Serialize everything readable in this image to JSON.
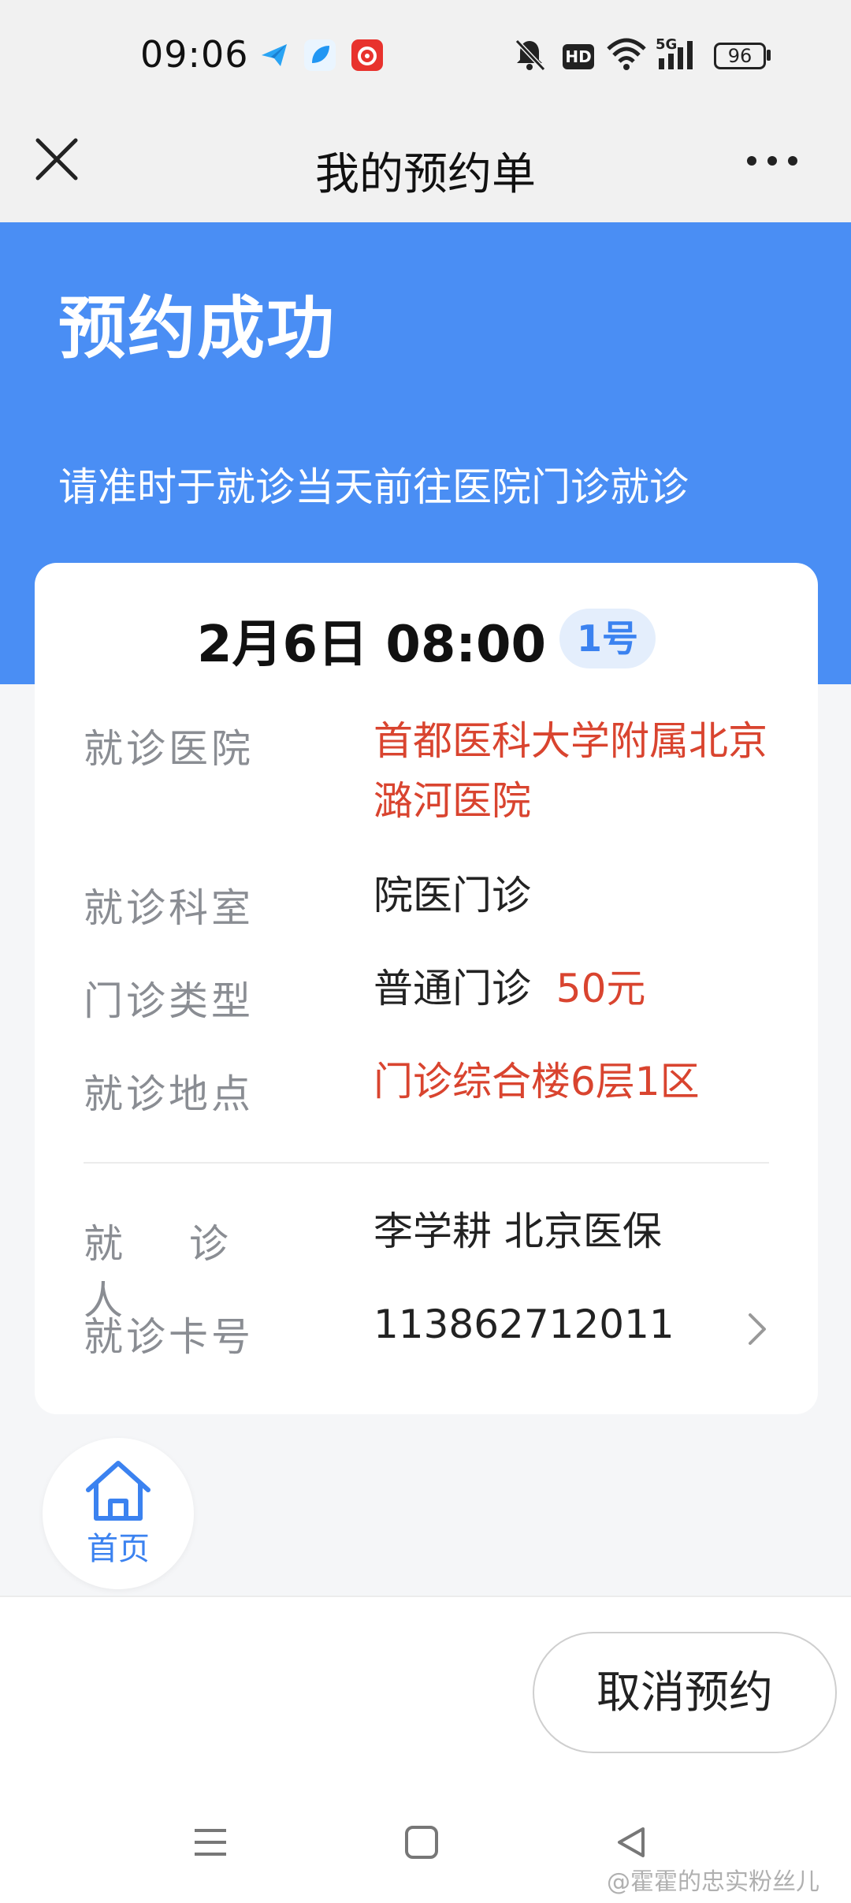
{
  "status_bar": {
    "time": "09:06",
    "battery": "96",
    "network": "5G",
    "hd": "HD"
  },
  "header": {
    "title": "我的预约单"
  },
  "hero": {
    "title": "预约成功",
    "subtitle": "请准时于就诊当天前往医院门诊就诊"
  },
  "appointment": {
    "datetime": "2月6日 08:00",
    "number": "1号",
    "rows": [
      {
        "label": "就诊医院",
        "value": "首都医科大学附属北京潞河医院"
      },
      {
        "label": "就诊科室",
        "value": "院医门诊"
      },
      {
        "label": "门诊类型",
        "value": "普通门诊",
        "fee": "50元"
      },
      {
        "label": "就诊地点",
        "value": "门诊综合楼6层1区"
      },
      {
        "label": "就 诊 人",
        "value": "李学耕 北京医保"
      },
      {
        "label": "就诊卡号",
        "value": "113862712011"
      }
    ]
  },
  "home_button": {
    "label": "首页"
  },
  "actions": {
    "cancel_label": "取消预约"
  },
  "watermark": "@霍霍的忠实粉丝儿",
  "colors": {
    "accent": "#4a8ef4",
    "highlight_red": "#d9442f",
    "link_blue": "#3b82f0"
  }
}
